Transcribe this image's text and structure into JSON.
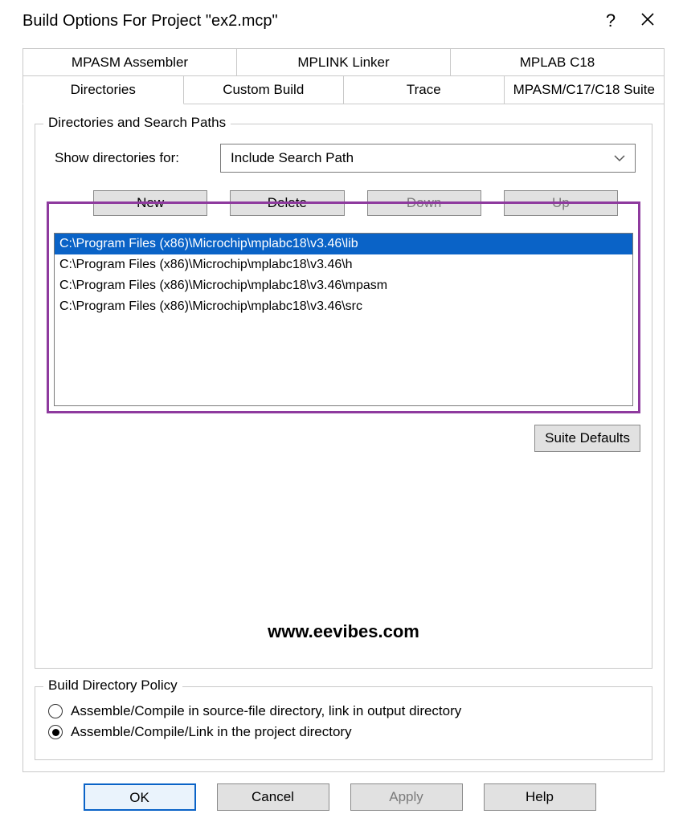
{
  "title": "Build Options For Project \"ex2.mcp\"",
  "tabs_row1": [
    "MPASM Assembler",
    "MPLINK Linker",
    "MPLAB C18"
  ],
  "tabs_row2": [
    "Directories",
    "Custom Build",
    "Trace",
    "MPASM/C17/C18 Suite"
  ],
  "active_tab": "Directories",
  "group1": {
    "legend": "Directories and Search Paths",
    "show_label": "Show directories for:",
    "show_value": "Include Search Path",
    "btn_new": "New",
    "btn_delete": "Delete",
    "btn_down": "Down",
    "btn_up": "Up",
    "paths": [
      "C:\\Program Files (x86)\\Microchip\\mplabc18\\v3.46\\lib",
      "C:\\Program Files (x86)\\Microchip\\mplabc18\\v3.46\\h",
      "C:\\Program Files (x86)\\Microchip\\mplabc18\\v3.46\\mpasm",
      "C:\\Program Files (x86)\\Microchip\\mplabc18\\v3.46\\src"
    ],
    "selected_index": 0,
    "suite_defaults": "Suite Defaults"
  },
  "watermark": "www.eevibes.com",
  "group2": {
    "legend": "Build Directory Policy",
    "opt1": "Assemble/Compile in source-file directory, link in output directory",
    "opt2": "Assemble/Compile/Link in the project directory",
    "selected": 1
  },
  "buttons": {
    "ok": "OK",
    "cancel": "Cancel",
    "apply": "Apply",
    "help": "Help"
  }
}
